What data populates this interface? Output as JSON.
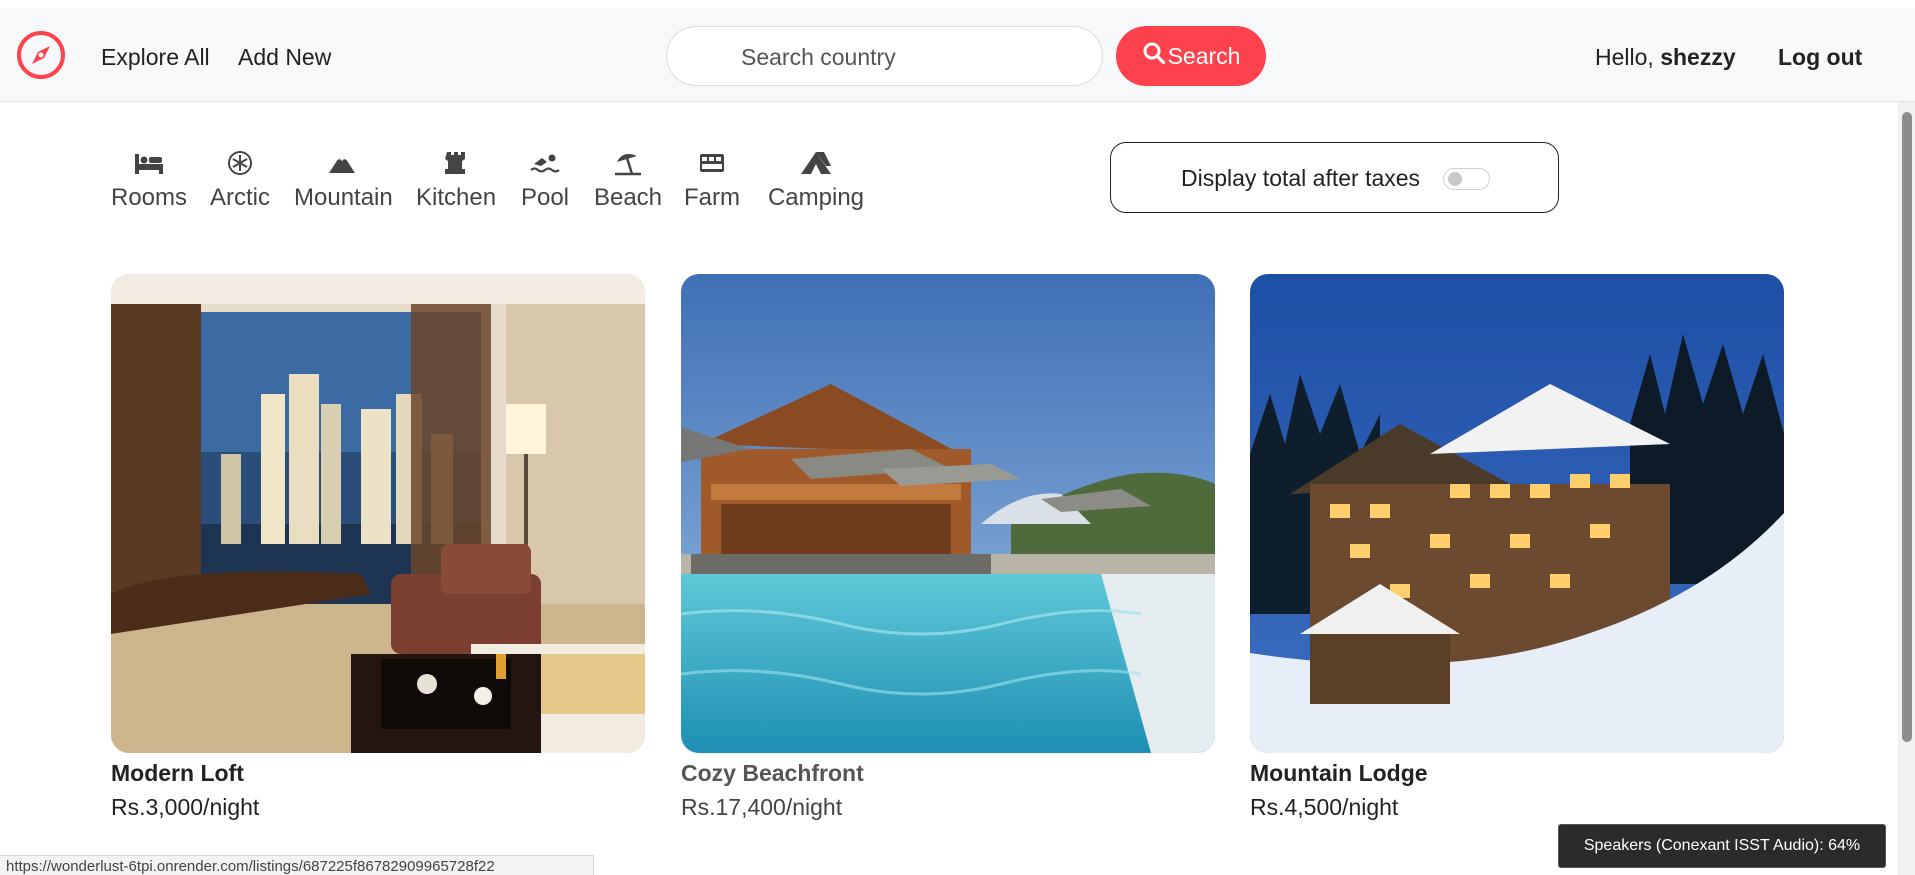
{
  "nav": {
    "explore_label": "Explore All",
    "add_label": "Add New",
    "search_placeholder": "Search country",
    "search_button_label": "Search",
    "greeting_prefix": "Hello,",
    "username": "shezzy",
    "logout_label": "Log out",
    "brand_color": "#fe424d"
  },
  "filters": [
    {
      "label": "Rooms",
      "icon": "bed-icon"
    },
    {
      "label": "Arctic",
      "icon": "snowflake-icon"
    },
    {
      "label": "Mountain",
      "icon": "mountain-icon"
    },
    {
      "label": "Kitchen",
      "icon": "chess-rook-icon"
    },
    {
      "label": "Pool",
      "icon": "swimmer-icon"
    },
    {
      "label": "Beach",
      "icon": "umbrella-beach-icon"
    },
    {
      "label": "Farm",
      "icon": "tractor-icon"
    },
    {
      "label": "Camping",
      "icon": "campground-icon"
    }
  ],
  "tax_toggle": {
    "label": "Display total after taxes",
    "enabled": false
  },
  "listings": [
    {
      "title": "Modern Loft",
      "price": "Rs.3,000/night",
      "image": "hotel-room-city-view-image"
    },
    {
      "title": "Cozy Beachfront",
      "price": "Rs.17,400/night",
      "image": "resort-pool-chalet-image"
    },
    {
      "title": "Mountain Lodge",
      "price": "Rs.4,500/night",
      "image": "snowy-mountain-lodge-image"
    }
  ],
  "status_bar": {
    "url": "https://wonderlust-6tpi.onrender.com/listings/687225f86782909965728f22"
  },
  "toast": {
    "text": "Speakers (Conexant ISST Audio): 64%"
  }
}
